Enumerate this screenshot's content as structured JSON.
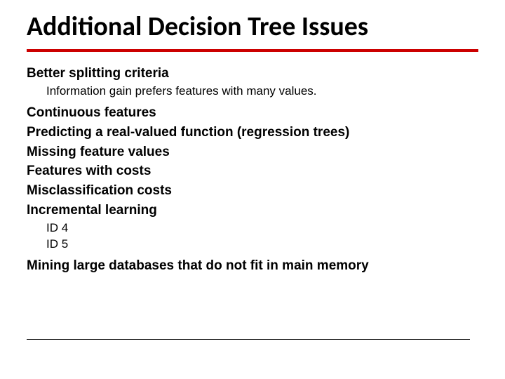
{
  "title": "Additional Decision Tree Issues",
  "items": {
    "i1": "Better splitting criteria",
    "i1a": "Information gain prefers features with many values.",
    "i2": "Continuous features",
    "i3": "Predicting a real-valued function (regression trees)",
    "i4": "Missing feature values",
    "i5": "Features with costs",
    "i6": "Misclassification costs",
    "i7": "Incremental learning",
    "i7a": "ID 4",
    "i7b": "ID 5",
    "i8": "Mining large databases that do not fit in main memory"
  }
}
